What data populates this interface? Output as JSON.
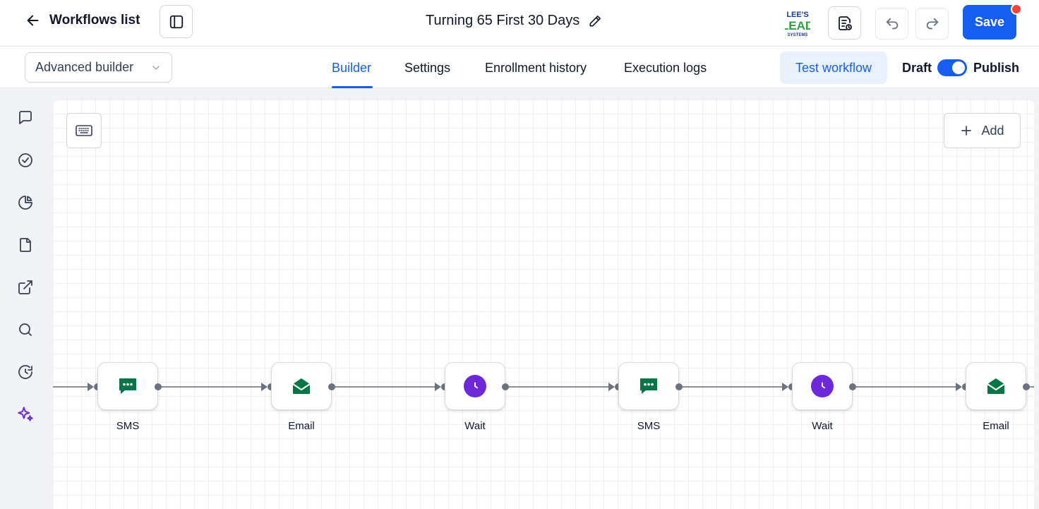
{
  "header": {
    "back_label": "Workflows list",
    "workflow_title": "Turning 65 First 30 Days",
    "save_label": "Save",
    "logo_text_line1": "LEE'S",
    "logo_text_line2": "LEAD",
    "logo_text_line3": "SYSTEMS"
  },
  "subbar": {
    "builder_mode": "Advanced builder",
    "tabs": [
      {
        "label": "Builder",
        "active": true
      },
      {
        "label": "Settings",
        "active": false
      },
      {
        "label": "Enrollment history",
        "active": false
      },
      {
        "label": "Execution logs",
        "active": false
      }
    ],
    "test_label": "Test workflow",
    "draft_label": "Draft",
    "publish_label": "Publish",
    "publish_enabled": true
  },
  "rail": {
    "icons": [
      "chat-icon",
      "check-circle-icon",
      "pie-chart-icon",
      "file-icon",
      "external-link-icon",
      "search-icon",
      "history-icon",
      "sparkles-icon"
    ]
  },
  "canvas": {
    "add_label": "Add",
    "nodes": [
      {
        "type": "sms",
        "label": "SMS"
      },
      {
        "type": "email",
        "label": "Email"
      },
      {
        "type": "wait",
        "label": "Wait"
      },
      {
        "type": "sms",
        "label": "SMS"
      },
      {
        "type": "wait",
        "label": "Wait"
      },
      {
        "type": "email",
        "label": "Email"
      }
    ]
  },
  "colors": {
    "primary": "#155eef",
    "sms_green": "#067647",
    "wait_purple": "#6d28d9",
    "notification_red": "#f04438"
  }
}
